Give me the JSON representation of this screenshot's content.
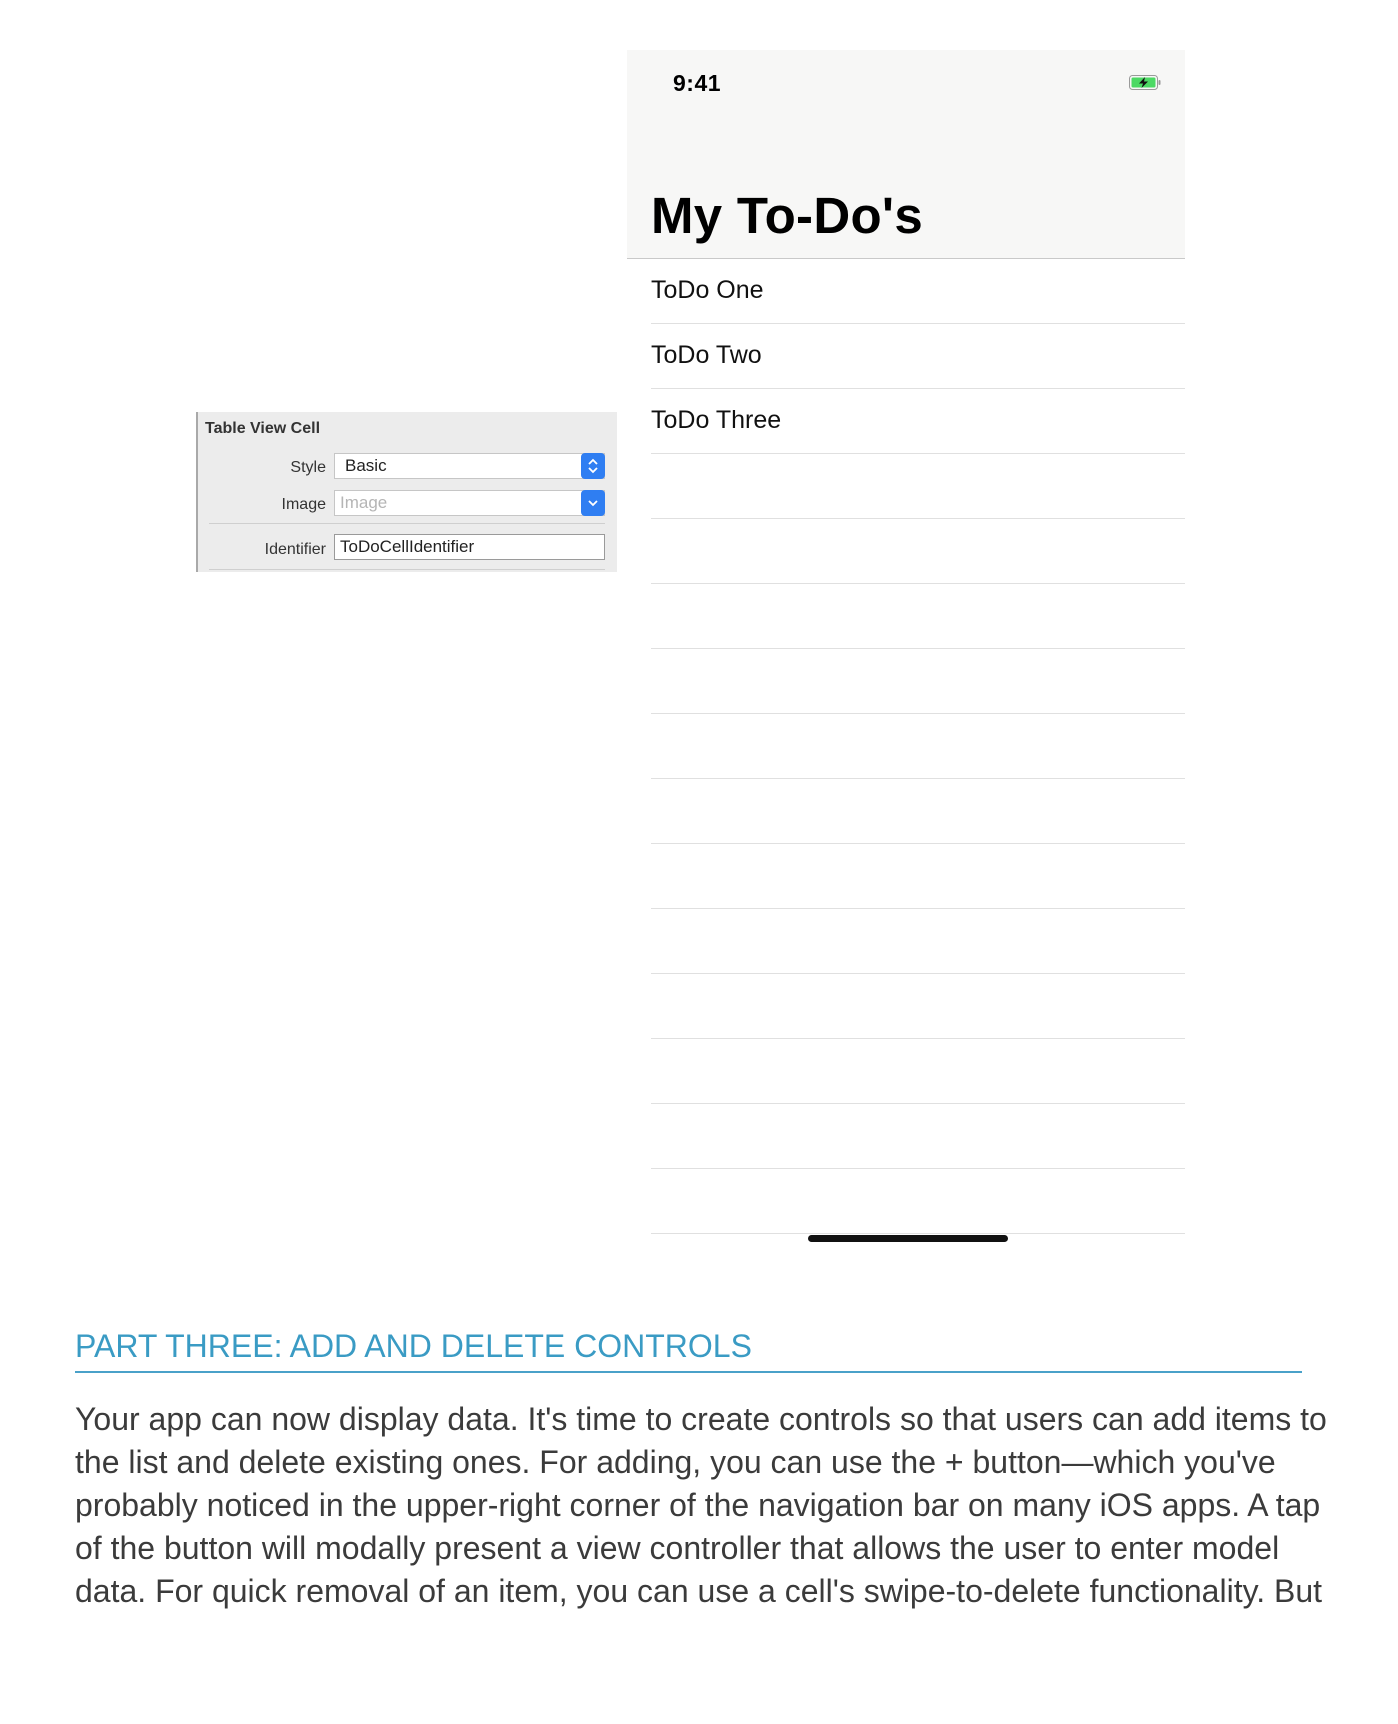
{
  "phone": {
    "status_time": "9:41",
    "nav_title": "My To-Do's",
    "rows": [
      "ToDo One",
      "ToDo Two",
      "ToDo Three",
      "",
      "",
      "",
      "",
      "",
      "",
      "",
      "",
      "",
      "",
      "",
      ""
    ],
    "battery_color": "#4cd964"
  },
  "inspector": {
    "title": "Table View Cell",
    "style_label": "Style",
    "style_value": "Basic",
    "image_label": "Image",
    "image_placeholder": "Image",
    "identifier_label": "Identifier",
    "identifier_value": "ToDoCellIdentifier",
    "accent_color": "#2f7ef2"
  },
  "doc": {
    "heading": "PART THREE: ADD AND DELETE CONTROLS",
    "paragraph_lines": [
      "Your app can now display data. It's time to create controls so that users can add items to",
      "the list and delete existing ones. For adding, you can use the + button—which you've",
      "probably noticed in the upper-right corner of the navigation bar on many iOS apps. A tap",
      "of the button will modally present a view controller that allows the user to enter model",
      "data. For quick removal of an item, you can use a cell's swipe-to-delete functionality. But"
    ]
  }
}
